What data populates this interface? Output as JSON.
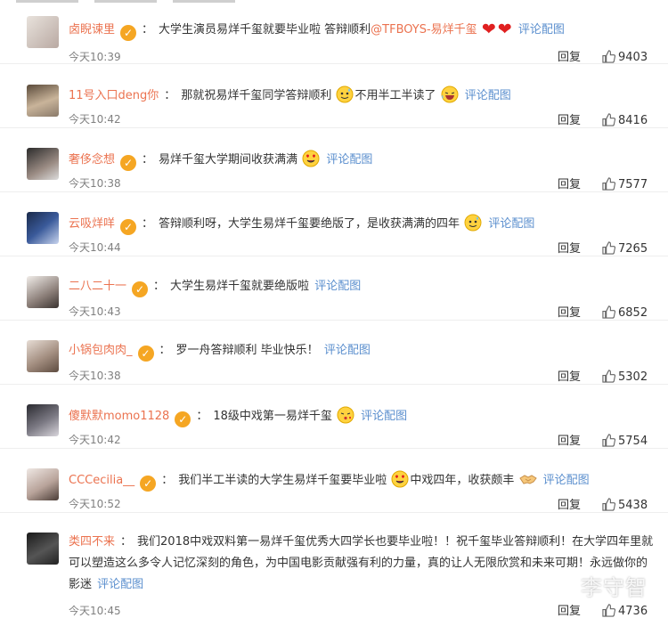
{
  "comments": [
    {
      "name": "卤睨谏里",
      "text": "大学生演员易烊千玺就要毕业啦 答辩顺利",
      "mention": "@TFBOYS-易烊千玺",
      "emojis": [
        "heart",
        "heart"
      ],
      "link": "评论配图",
      "time": "今天10:39",
      "reply": "回复",
      "likes": "9403"
    },
    {
      "name": "11号入口deng你",
      "text": "那就祝易烊千玺同学答辩顺利",
      "emoji_mid": "sweat",
      "text2": "不用半工半读了",
      "emojis": [
        "laugh"
      ],
      "link": "评论配图",
      "time": "今天10:42",
      "reply": "回复",
      "likes": "8416"
    },
    {
      "name": "奢侈念想",
      "text": "易烊千玺大学期间收获满满",
      "emojis": [
        "heart-eyes"
      ],
      "link": "评论配图",
      "time": "今天10:38",
      "reply": "回复",
      "likes": "7577"
    },
    {
      "name": "云吸烊咩",
      "text": "答辩顺利呀，大学生易烊千玺要绝版了，是收获满满的四年",
      "emojis": [
        "sweat"
      ],
      "link": "评论配图",
      "time": "今天10:44",
      "reply": "回复",
      "likes": "7265"
    },
    {
      "name": "二八二十一",
      "text": "大学生易烊千玺就要绝版啦",
      "link": "评论配图",
      "time": "今天10:43",
      "reply": "回复",
      "likes": "6852"
    },
    {
      "name": "小锅包肉肉_",
      "text": "罗一舟答辩顺利 毕业快乐！",
      "link": "评论配图",
      "time": "今天10:38",
      "reply": "回复",
      "likes": "5302"
    },
    {
      "name": "傻默默momo1128",
      "text": "18级中戏第一易烊千玺",
      "emojis": [
        "kiss"
      ],
      "link": "评论配图",
      "time": "今天10:42",
      "reply": "回复",
      "likes": "5754"
    },
    {
      "name": "CCCecilia__",
      "text": "我们半工半读的大学生易烊千玺要毕业啦",
      "emoji_mid": "heart-eyes",
      "text2": "中戏四年，收获颇丰",
      "emojis": [
        "handshake"
      ],
      "link": "评论配图",
      "time": "今天10:52",
      "reply": "回复",
      "likes": "5438"
    },
    {
      "name": "类四不来",
      "text": "我们2018中戏双料第一易烊千玺优秀大四学长也要毕业啦！！祝千玺毕业答辩顺利！在大学四年里就可以塑造这么多令人记忆深刻的角色，为中国电影贡献强有利的力量，真的让人无限欣赏和未来可期！永远做你的影迷",
      "link": "评论配图",
      "time": "今天10:45",
      "reply": "回复",
      "likes": "4736"
    }
  ],
  "watermark": "李守智",
  "colors": {
    "name": "#eb7350",
    "link": "#5b8fce",
    "vbadge": "#f5a623",
    "time": "#808080"
  }
}
